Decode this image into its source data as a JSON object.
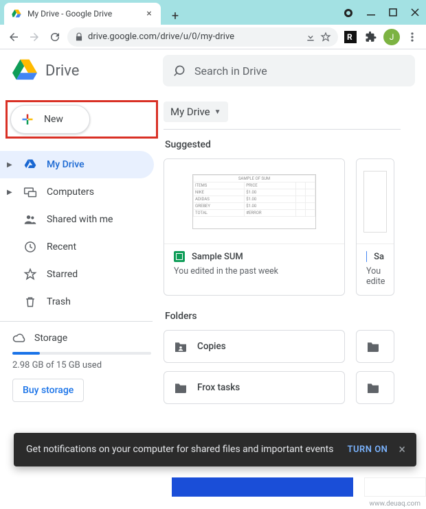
{
  "browser": {
    "tab_title": "My Drive - Google Drive",
    "url": "drive.google.com/drive/u/0/my-drive",
    "avatar_letter": "J"
  },
  "header": {
    "product": "Drive",
    "search_placeholder": "Search in Drive"
  },
  "new_button": {
    "label": "New"
  },
  "sidebar": {
    "items": [
      {
        "label": "My Drive",
        "icon": "drive",
        "active": true,
        "children": true
      },
      {
        "label": "Computers",
        "icon": "computers",
        "active": false,
        "children": true
      },
      {
        "label": "Shared with me",
        "icon": "shared",
        "active": false,
        "children": false
      },
      {
        "label": "Recent",
        "icon": "recent",
        "active": false,
        "children": false
      },
      {
        "label": "Starred",
        "icon": "starred",
        "active": false,
        "children": false
      },
      {
        "label": "Trash",
        "icon": "trash",
        "active": false,
        "children": false
      }
    ]
  },
  "storage": {
    "label": "Storage",
    "text": "2.98 GB of 15 GB used",
    "percent": 20,
    "buy": "Buy storage"
  },
  "breadcrumb": {
    "current": "My Drive"
  },
  "sections": {
    "suggested": "Suggested",
    "folders": "Folders"
  },
  "suggested": [
    {
      "title": "Sample SUM",
      "subtitle": "You edited in the past week",
      "type": "sheets"
    },
    {
      "title": "Sa",
      "subtitle": "You edite",
      "type": "docs"
    }
  ],
  "folders": [
    {
      "name": "Copies",
      "shared": true
    },
    {
      "name": "Frox tasks",
      "shared": false
    }
  ],
  "snackbar": {
    "text": "Get notifications on your computer for shared files and important events",
    "action": "TURN ON"
  },
  "watermark": "www.deuaq.com"
}
